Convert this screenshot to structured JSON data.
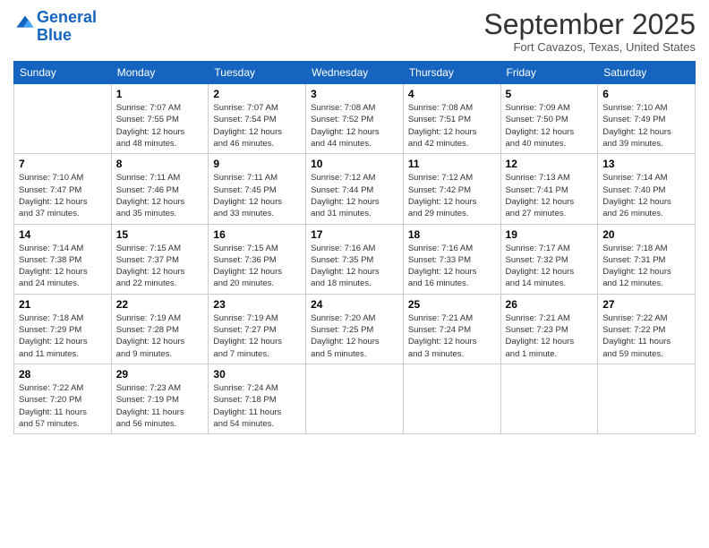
{
  "header": {
    "logo_line1": "General",
    "logo_line2": "Blue",
    "month": "September 2025",
    "location": "Fort Cavazos, Texas, United States"
  },
  "days_of_week": [
    "Sunday",
    "Monday",
    "Tuesday",
    "Wednesday",
    "Thursday",
    "Friday",
    "Saturday"
  ],
  "weeks": [
    [
      {
        "day": "",
        "info": ""
      },
      {
        "day": "1",
        "info": "Sunrise: 7:07 AM\nSunset: 7:55 PM\nDaylight: 12 hours\nand 48 minutes."
      },
      {
        "day": "2",
        "info": "Sunrise: 7:07 AM\nSunset: 7:54 PM\nDaylight: 12 hours\nand 46 minutes."
      },
      {
        "day": "3",
        "info": "Sunrise: 7:08 AM\nSunset: 7:52 PM\nDaylight: 12 hours\nand 44 minutes."
      },
      {
        "day": "4",
        "info": "Sunrise: 7:08 AM\nSunset: 7:51 PM\nDaylight: 12 hours\nand 42 minutes."
      },
      {
        "day": "5",
        "info": "Sunrise: 7:09 AM\nSunset: 7:50 PM\nDaylight: 12 hours\nand 40 minutes."
      },
      {
        "day": "6",
        "info": "Sunrise: 7:10 AM\nSunset: 7:49 PM\nDaylight: 12 hours\nand 39 minutes."
      }
    ],
    [
      {
        "day": "7",
        "info": "Sunrise: 7:10 AM\nSunset: 7:47 PM\nDaylight: 12 hours\nand 37 minutes."
      },
      {
        "day": "8",
        "info": "Sunrise: 7:11 AM\nSunset: 7:46 PM\nDaylight: 12 hours\nand 35 minutes."
      },
      {
        "day": "9",
        "info": "Sunrise: 7:11 AM\nSunset: 7:45 PM\nDaylight: 12 hours\nand 33 minutes."
      },
      {
        "day": "10",
        "info": "Sunrise: 7:12 AM\nSunset: 7:44 PM\nDaylight: 12 hours\nand 31 minutes."
      },
      {
        "day": "11",
        "info": "Sunrise: 7:12 AM\nSunset: 7:42 PM\nDaylight: 12 hours\nand 29 minutes."
      },
      {
        "day": "12",
        "info": "Sunrise: 7:13 AM\nSunset: 7:41 PM\nDaylight: 12 hours\nand 27 minutes."
      },
      {
        "day": "13",
        "info": "Sunrise: 7:14 AM\nSunset: 7:40 PM\nDaylight: 12 hours\nand 26 minutes."
      }
    ],
    [
      {
        "day": "14",
        "info": "Sunrise: 7:14 AM\nSunset: 7:38 PM\nDaylight: 12 hours\nand 24 minutes."
      },
      {
        "day": "15",
        "info": "Sunrise: 7:15 AM\nSunset: 7:37 PM\nDaylight: 12 hours\nand 22 minutes."
      },
      {
        "day": "16",
        "info": "Sunrise: 7:15 AM\nSunset: 7:36 PM\nDaylight: 12 hours\nand 20 minutes."
      },
      {
        "day": "17",
        "info": "Sunrise: 7:16 AM\nSunset: 7:35 PM\nDaylight: 12 hours\nand 18 minutes."
      },
      {
        "day": "18",
        "info": "Sunrise: 7:16 AM\nSunset: 7:33 PM\nDaylight: 12 hours\nand 16 minutes."
      },
      {
        "day": "19",
        "info": "Sunrise: 7:17 AM\nSunset: 7:32 PM\nDaylight: 12 hours\nand 14 minutes."
      },
      {
        "day": "20",
        "info": "Sunrise: 7:18 AM\nSunset: 7:31 PM\nDaylight: 12 hours\nand 12 minutes."
      }
    ],
    [
      {
        "day": "21",
        "info": "Sunrise: 7:18 AM\nSunset: 7:29 PM\nDaylight: 12 hours\nand 11 minutes."
      },
      {
        "day": "22",
        "info": "Sunrise: 7:19 AM\nSunset: 7:28 PM\nDaylight: 12 hours\nand 9 minutes."
      },
      {
        "day": "23",
        "info": "Sunrise: 7:19 AM\nSunset: 7:27 PM\nDaylight: 12 hours\nand 7 minutes."
      },
      {
        "day": "24",
        "info": "Sunrise: 7:20 AM\nSunset: 7:25 PM\nDaylight: 12 hours\nand 5 minutes."
      },
      {
        "day": "25",
        "info": "Sunrise: 7:21 AM\nSunset: 7:24 PM\nDaylight: 12 hours\nand 3 minutes."
      },
      {
        "day": "26",
        "info": "Sunrise: 7:21 AM\nSunset: 7:23 PM\nDaylight: 12 hours\nand 1 minute."
      },
      {
        "day": "27",
        "info": "Sunrise: 7:22 AM\nSunset: 7:22 PM\nDaylight: 11 hours\nand 59 minutes."
      }
    ],
    [
      {
        "day": "28",
        "info": "Sunrise: 7:22 AM\nSunset: 7:20 PM\nDaylight: 11 hours\nand 57 minutes."
      },
      {
        "day": "29",
        "info": "Sunrise: 7:23 AM\nSunset: 7:19 PM\nDaylight: 11 hours\nand 56 minutes."
      },
      {
        "day": "30",
        "info": "Sunrise: 7:24 AM\nSunset: 7:18 PM\nDaylight: 11 hours\nand 54 minutes."
      },
      {
        "day": "",
        "info": ""
      },
      {
        "day": "",
        "info": ""
      },
      {
        "day": "",
        "info": ""
      },
      {
        "day": "",
        "info": ""
      }
    ]
  ]
}
